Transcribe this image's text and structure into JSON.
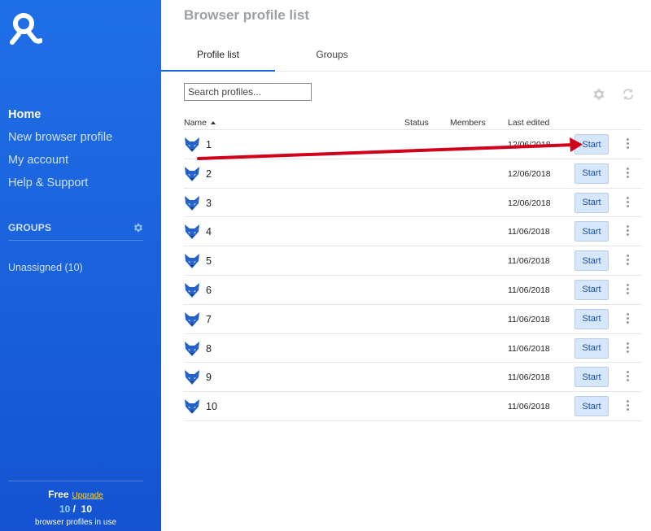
{
  "sidebar": {
    "logo": "app-logo",
    "nav": [
      {
        "label": "Home",
        "active": true
      },
      {
        "label": "New browser profile"
      },
      {
        "label": "My account"
      },
      {
        "label": "Help & Support"
      }
    ],
    "groups_heading": "GROUPS",
    "groups": [
      {
        "label": "Unassigned (10)"
      }
    ],
    "plan": {
      "name": "Free",
      "upgrade_label": "Upgrade",
      "used": "10",
      "separator": "/",
      "total": "10",
      "caption": "browser profiles in use"
    }
  },
  "main": {
    "title": "Browser profile list",
    "tabs": [
      {
        "label": "Profile list",
        "active": true
      },
      {
        "label": "Groups"
      }
    ],
    "search": {
      "placeholder": "Search profiles..."
    },
    "toolbar_icons": [
      "gear-icon",
      "sync-icon"
    ],
    "table": {
      "columns": {
        "name": "Name",
        "status": "Status",
        "members": "Members",
        "last_edited": "Last edited"
      },
      "start_label": "Start",
      "rows": [
        {
          "name": "1",
          "last_edited": "12/06/2018"
        },
        {
          "name": "2",
          "last_edited": "12/06/2018"
        },
        {
          "name": "3",
          "last_edited": "12/06/2018"
        },
        {
          "name": "4",
          "last_edited": "11/06/2018"
        },
        {
          "name": "5",
          "last_edited": "11/06/2018"
        },
        {
          "name": "6",
          "last_edited": "11/06/2018"
        },
        {
          "name": "7",
          "last_edited": "11/06/2018"
        },
        {
          "name": "8",
          "last_edited": "11/06/2018"
        },
        {
          "name": "9",
          "last_edited": "11/06/2018"
        },
        {
          "name": "10",
          "last_edited": "11/06/2018"
        }
      ]
    }
  },
  "colors": {
    "sidebar": "#1a62dc",
    "accent": "#1c64dc",
    "start_button": "#d6e6fb",
    "annotation_arrow": "#d0021b",
    "upgrade": "#ffd83a"
  }
}
